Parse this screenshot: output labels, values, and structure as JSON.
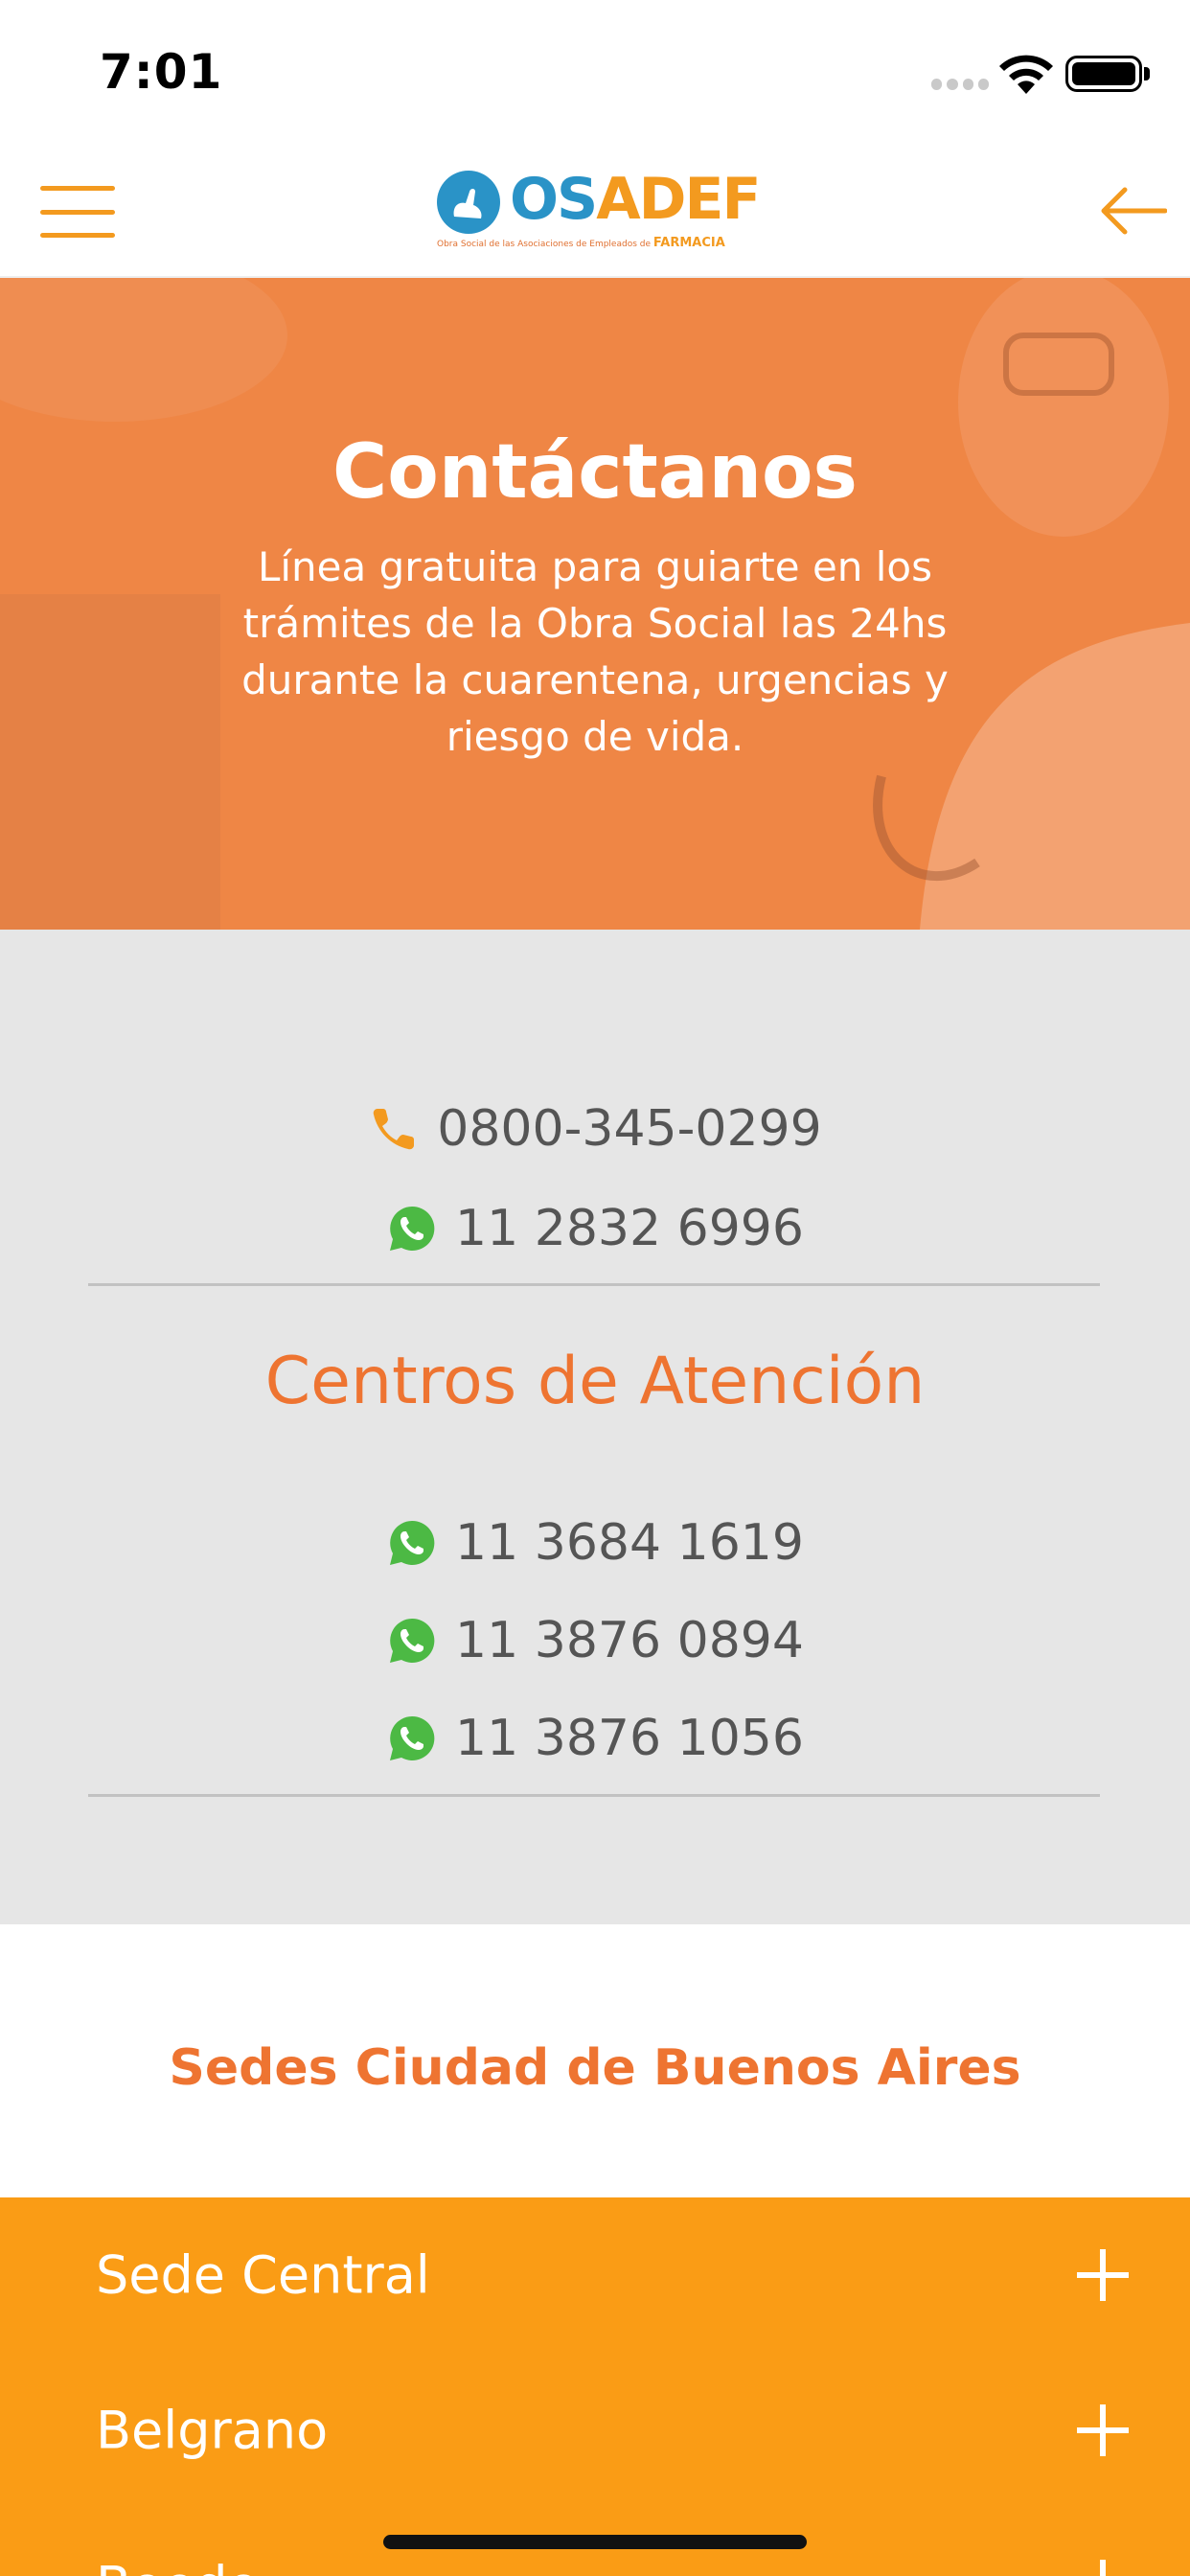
{
  "status_bar": {
    "time": "7:01"
  },
  "header": {
    "logo": {
      "os": "OS",
      "adef": "ADEF",
      "tagline": "Obra Social de las Asociaciones de Empleados de",
      "tagline_bold": "FARMACIA"
    },
    "menu_icon": "hamburger-icon",
    "back_icon": "arrow-left-icon"
  },
  "hero": {
    "title": "Contáctanos",
    "description": "Línea gratuita para guiarte en los trámites de la Obra Social las 24hs durante la cuarentena, urgencias y riesgo de vida."
  },
  "contact": {
    "phone": {
      "icon": "phone-icon",
      "number": "0800-345-0299"
    },
    "whatsapp": {
      "icon": "whatsapp-icon",
      "number": "11 2832 6996"
    },
    "centros_title": "Centros de Atención",
    "centros": [
      {
        "icon": "whatsapp-icon",
        "number": "11 3684 1619"
      },
      {
        "icon": "whatsapp-icon",
        "number": "11 3876 0894"
      },
      {
        "icon": "whatsapp-icon",
        "number": "11 3876 1056"
      }
    ]
  },
  "sedes": {
    "title": "Sedes Ciudad de Buenos Aires",
    "items": [
      {
        "label": "Sede Central"
      },
      {
        "label": "Belgrano"
      },
      {
        "label": "Boedo"
      }
    ]
  },
  "colors": {
    "accent_orange": "#ee7431",
    "hero_orange": "#ef8645",
    "accordion_orange": "#fa9c15",
    "whatsapp_green": "#4cb944",
    "logo_blue": "#2a93c7"
  }
}
